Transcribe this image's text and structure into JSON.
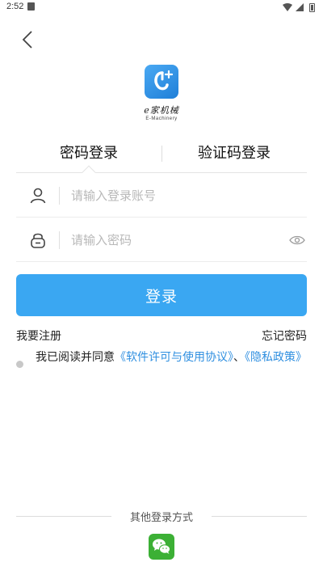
{
  "status_bar": {
    "time": "2:52"
  },
  "logo": {
    "text": "e家机械",
    "subtext": "E-Machinery"
  },
  "tabs": {
    "password_label": "密码登录",
    "sms_label": "验证码登录"
  },
  "account_field": {
    "placeholder": "请输入登录账号",
    "value": ""
  },
  "password_field": {
    "placeholder": "请输入密码",
    "value": ""
  },
  "login_button": {
    "label": "登录"
  },
  "links": {
    "register": "我要注册",
    "forgot": "忘记密码"
  },
  "agreement": {
    "prefix": "我已阅读并同意",
    "terms": "《软件许可与使用协议》",
    "separator": "、",
    "privacy": "《隐私政策》"
  },
  "other_login": {
    "label": "其他登录方式"
  },
  "colors": {
    "accent": "#3aa7f2",
    "link": "#2f8fe0",
    "wechat": "#3cb035"
  }
}
